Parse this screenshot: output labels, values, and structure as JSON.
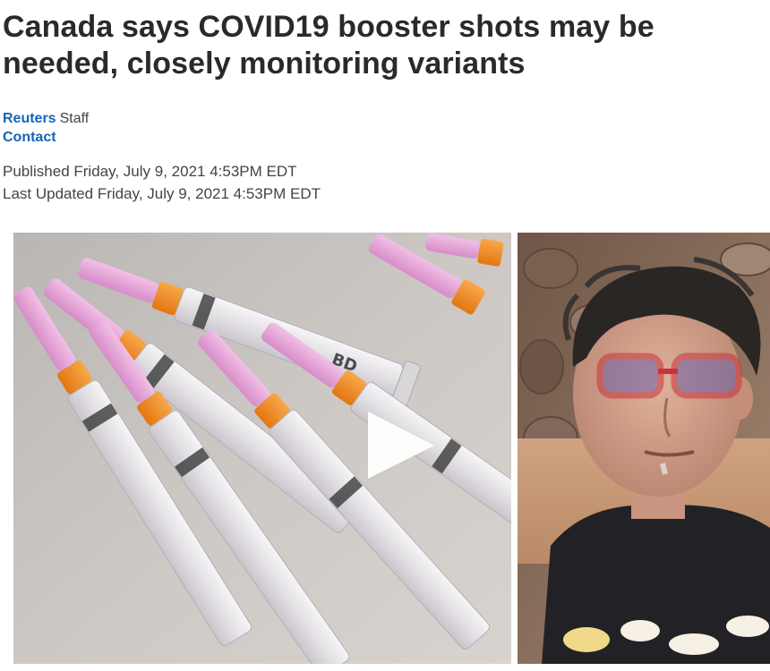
{
  "article": {
    "headline": "Canada says COVID19 booster shots may be needed, closely monitoring variants",
    "author": "Reuters",
    "author_role": "Staff",
    "contact_label": "Contact",
    "published": "Published Friday, July 9, 2021 4:53PM EDT",
    "updated": "Last Updated Friday, July 9, 2021 4:53PM EDT"
  },
  "video": {
    "play_icon": "play-icon",
    "syringe_print": "BD",
    "colors": {
      "syringe_cap": "#e8a6d8",
      "syringe_hub": "#f0861c",
      "syringe_barrel": "#e9e6ea",
      "table": "#c9c4c0",
      "stone_wall": "#8b715e",
      "glasses": "#c8323d",
      "shirt": "#222226"
    }
  }
}
